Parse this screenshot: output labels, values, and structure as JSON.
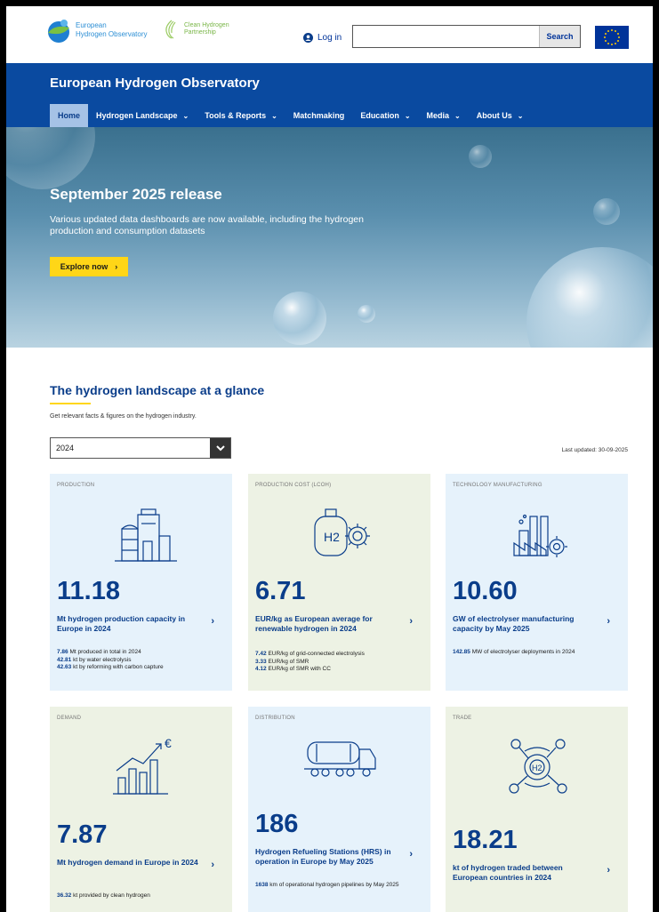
{
  "topbar": {
    "eho_logo_line1": "European",
    "eho_logo_line2": "Hydrogen Observatory",
    "chp_logo_line1": "Clean Hydrogen",
    "chp_logo_line2": "Partnership",
    "login_label": "Log in",
    "search_value": "",
    "search_button": "Search"
  },
  "header": {
    "title": "European Hydrogen Observatory",
    "nav": [
      {
        "label": "Home",
        "has_dropdown": false
      },
      {
        "label": "Hydrogen Landscape",
        "has_dropdown": true
      },
      {
        "label": "Tools & Reports",
        "has_dropdown": true
      },
      {
        "label": "Matchmaking",
        "has_dropdown": false
      },
      {
        "label": "Education",
        "has_dropdown": true
      },
      {
        "label": "Media",
        "has_dropdown": true
      },
      {
        "label": "About Us",
        "has_dropdown": true
      }
    ]
  },
  "hero": {
    "title": "September 2025 release",
    "text": "Various updated data dashboards are now available, including the hydrogen production and consumption datasets",
    "button": "Explore now",
    "button_arrow": "›"
  },
  "landscape": {
    "title": "The hydrogen landscape at a glance",
    "subtitle": "Get relevant facts & figures on the hydrogen industry.",
    "year": "2024",
    "last_updated": "Last updated: 30-09-2025"
  },
  "cards": [
    {
      "category": "PRODUCTION",
      "icon": "factory-tanks-icon",
      "value": "11.18",
      "desc": "Mt hydrogen production capacity in Europe in 2024",
      "details": [
        {
          "num": "7.86",
          "text": " Mt produced in total in 2024"
        },
        {
          "num": "42.81",
          "text": " kt by water electrolysis"
        },
        {
          "num": "42.63",
          "text": " kt by reforming with carbon capture"
        }
      ]
    },
    {
      "category": "PRODUCTION COST (LCOH)",
      "icon": "h2-tank-gear-icon",
      "value": "6.71",
      "desc": "EUR/kg as European average for renewable hydrogen in 2024",
      "details": [
        {
          "num": "7.42",
          "text": " EUR/kg of grid-connected electrolysis"
        },
        {
          "num": "3.33",
          "text": " EUR/kg of SMR"
        },
        {
          "num": "4.12",
          "text": " EUR/kg of SMR with CC"
        }
      ]
    },
    {
      "category": "TECHNOLOGY MANUFACTURING",
      "icon": "manufacturing-plant-icon",
      "value": "10.60",
      "desc": "GW of electrolyser manufacturing capacity by May 2025",
      "details": [
        {
          "num": "142.85",
          "text": " MW of electrolyser deployments in 2024"
        }
      ]
    },
    {
      "category": "DEMAND",
      "icon": "bar-chart-euro-icon",
      "value": "7.87",
      "desc": "Mt hydrogen demand in Europe in 2024",
      "details": [
        {
          "num": "36.32",
          "text": " kt provided by clean hydrogen"
        }
      ]
    },
    {
      "category": "DISTRIBUTION",
      "icon": "tanker-truck-icon",
      "value": "186",
      "desc": "Hydrogen Refueling Stations (HRS) in operation in Europe by May 2025",
      "details": [
        {
          "num": "1638",
          "text": " km of operational hydrogen pipelines by May 2025"
        }
      ]
    },
    {
      "category": "TRADE",
      "icon": "h2-network-icon",
      "value": "18.21",
      "desc": "kt of hydrogen traded between European countries in 2024",
      "details": []
    }
  ],
  "colors": {
    "brand_blue": "#0a4aa0",
    "title_blue": "#0a3d8a",
    "accent_yellow": "#ffd617",
    "card_blue": "#e6f2fb",
    "card_green": "#edf2e4"
  }
}
